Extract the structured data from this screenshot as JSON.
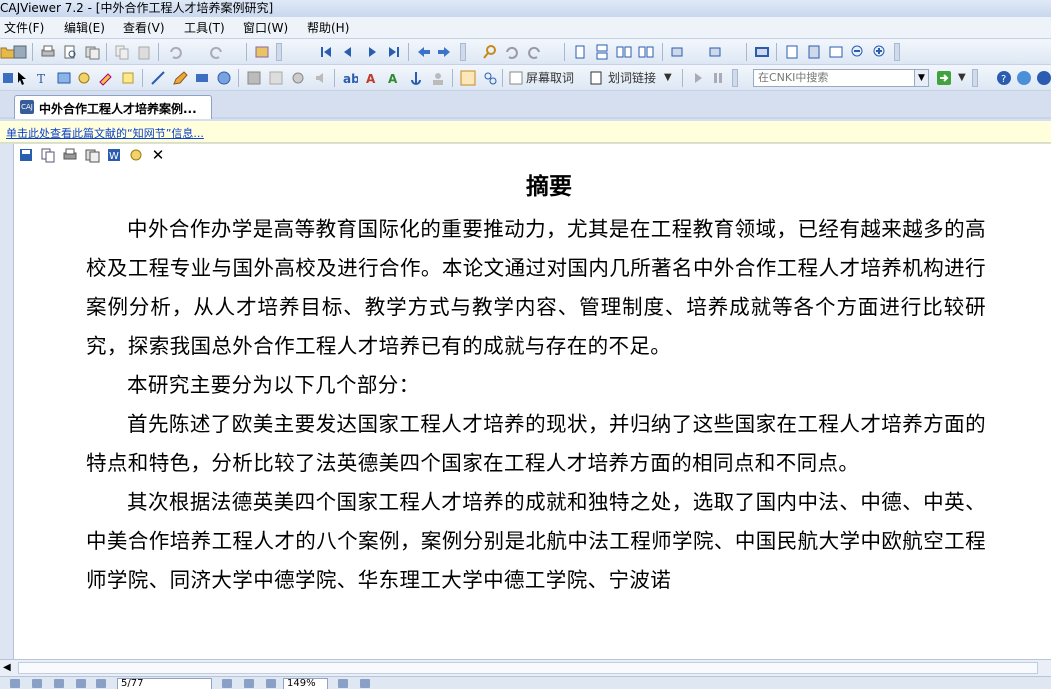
{
  "window": {
    "title": "CAJViewer 7.2 - [中外合作工程人才培养案例研究]"
  },
  "menu": {
    "items": [
      "文件(F)",
      "编辑(E)",
      "查看(V)",
      "工具(T)",
      "窗口(W)",
      "帮助(H)"
    ]
  },
  "toolbar2": {
    "screen_word_label": "屏幕取词",
    "word_link_label": "划词链接",
    "search_placeholder": "在CNKI中搜索"
  },
  "tab": {
    "label": "中外合作工程人才培养案例..."
  },
  "infobar": {
    "link": "单击此处查看此篇文献的“知网节”信息..."
  },
  "document": {
    "title": "摘要",
    "paragraphs": [
      "中外合作办学是高等教育国际化的重要推动力，尤其是在工程教育领域，已经有越来越多的高校及工程专业与国外高校及进行合作。本论文通过对国内几所著名中外合作工程人才培养机构进行案例分析，从人才培养目标、教学方式与教学内容、管理制度、培养成就等各个方面进行比较研究，探索我国总外合作工程人才培养已有的成就与存在的不足。",
      "本研究主要分为以下几个部分：",
      "首先陈述了欧美主要发达国家工程人才培养的现状，并归纳了这些国家在工程人才培养方面的特点和特色，分析比较了法英德美四个国家在工程人才培养方面的相同点和不同点。",
      "其次根据法德英美四个国家工程人才培养的成就和独特之处，选取了国内中法、中德、中英、中美合作培养工程人才的八个案例，案例分别是北航中法工程师学院、中国民航大学中欧航空工程师学院、同济大学中德学院、华东理工大学中德工学院、宁波诺"
    ]
  },
  "status": {
    "page": "5/77",
    "zoom": "149%"
  }
}
